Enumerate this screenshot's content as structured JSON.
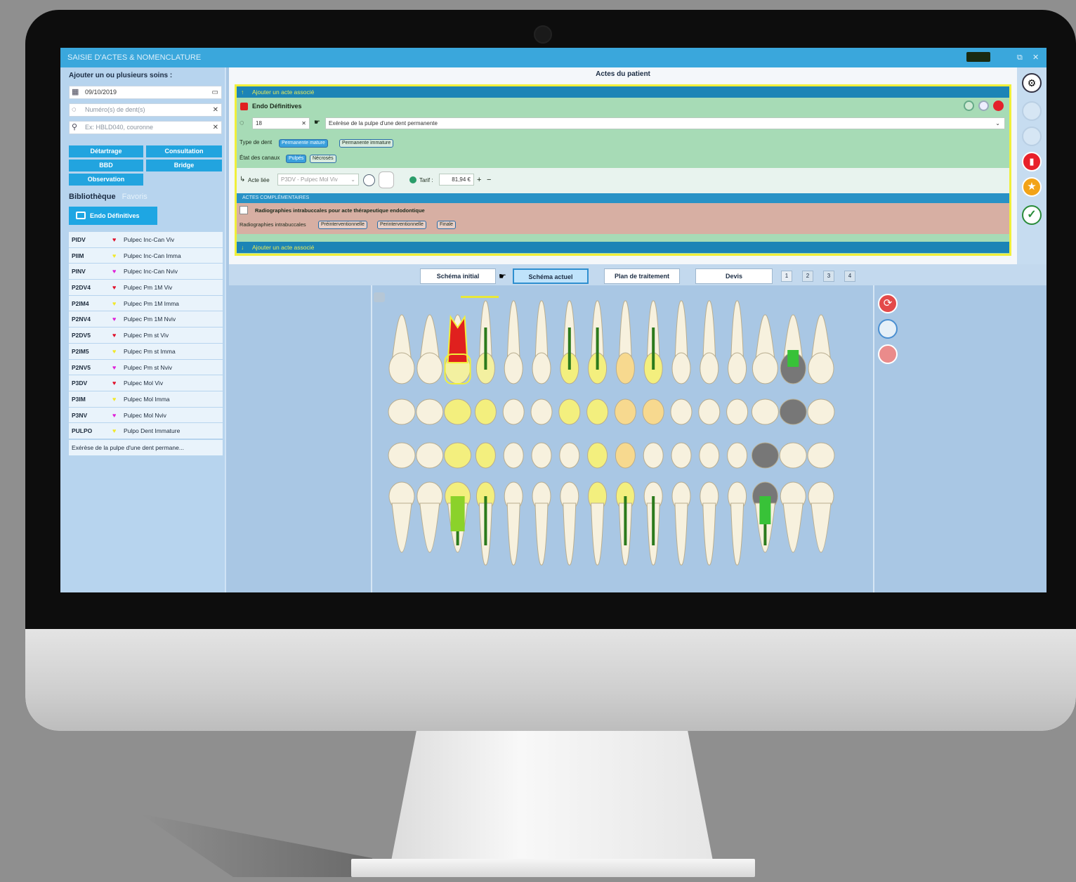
{
  "app": {
    "title": "SAISIE D'ACTES & NOMENCLATURE"
  },
  "left_panel": {
    "heading": "Ajouter un ou plusieurs soins :",
    "date_value": "09/10/2019",
    "teeth_placeholder": "Numéro(s) de dent(s)",
    "code_placeholder": "Ex: HBLD040, couronne",
    "quick_buttons": [
      "Détartrage",
      "Consultation",
      "BBD",
      "Bridge",
      "Observation"
    ],
    "tab_library": "Bibliothèque",
    "tab_favorites": "Favoris",
    "library_button": "Endo Définitives",
    "library_items": [
      {
        "code": "PIDV",
        "label": "Pulpec Inc-Can Viv",
        "color": "#e0102a"
      },
      {
        "code": "PIIM",
        "label": "Pulpec Inc-Can Imma",
        "color": "#f2e82a"
      },
      {
        "code": "PINV",
        "label": "Pulpec Inc-Can Nviv",
        "color": "#e020d8"
      },
      {
        "code": "P2DV4",
        "label": "Pulpec Pm 1M Viv",
        "color": "#e0102a"
      },
      {
        "code": "P2IM4",
        "label": "Pulpec Pm 1M Imma",
        "color": "#f2e82a"
      },
      {
        "code": "P2NV4",
        "label": "Pulpec Pm 1M Nviv",
        "color": "#e020d8"
      },
      {
        "code": "P2DV5",
        "label": "Pulpec Pm st Viv",
        "color": "#e0102a"
      },
      {
        "code": "P2IM5",
        "label": "Pulpec Pm st Imma",
        "color": "#f2e82a"
      },
      {
        "code": "P2NV5",
        "label": "Pulpec Pm st Nviv",
        "color": "#e020d8"
      },
      {
        "code": "P3DV",
        "label": "Pulpec Mol Viv",
        "color": "#e0102a"
      },
      {
        "code": "P3IM",
        "label": "Pulpec Mol Imma",
        "color": "#f2e82a"
      },
      {
        "code": "P3NV",
        "label": "Pulpec Mol Nviv",
        "color": "#e020d8"
      },
      {
        "code": "PULPO",
        "label": "Pulpo Dent Immature",
        "color": "#f2e82a"
      }
    ],
    "library_footer": "Exérèse de la pulpe d'une dent permane..."
  },
  "acte": {
    "panel_title": "Actes du patient",
    "add_associated_top": "Ajouter un acte associé",
    "act_name": "Endo Définitives",
    "tooth_number": "18",
    "act_description": "Exérèse de la pulpe d'une dent permanente",
    "type_label": "Type de dent",
    "type_options": [
      "Permanente mature",
      "Permanente immature"
    ],
    "state_label": "État des canaux",
    "state_options": [
      "Pulpés",
      "Nécrosés"
    ],
    "linked_label": "Acte liée",
    "linked_value": "P3DV - Pulpec Mol Viv",
    "tarif_label": "Tarif :",
    "tarif_value": "81,94 €",
    "complementary_heading": "ACTES COMPLÉMENTAIRES",
    "complementary_item": "Radiographies intrabuccales pour acte thérapeutique endodontique",
    "radio_label": "Radiographies intrabuccales",
    "radio_options": [
      "Préinterventionnelle",
      "Perinterventionnelle",
      "Finale"
    ],
    "add_associated_bottom": "Ajouter un acte associé"
  },
  "schema": {
    "tabs": [
      "Schéma initial",
      "Schéma actuel",
      "Plan de traitement",
      "Devis"
    ],
    "active_tab": "Schéma actuel",
    "pages": [
      "1",
      "2",
      "3",
      "4"
    ]
  },
  "colors": {
    "accent": "#3aa7dc",
    "selection": "#f0ef3a",
    "acte_bg": "#a7dbb6",
    "complement_bg": "#d7afa3"
  },
  "icons": {
    "rail": [
      "settings-icon",
      "circle-disabled-icon",
      "circle-disabled-icon",
      "trash-icon",
      "star-icon",
      "check-icon"
    ],
    "chart_side": [
      "refresh-icon",
      "tooth-icon",
      "ear-icon"
    ]
  }
}
